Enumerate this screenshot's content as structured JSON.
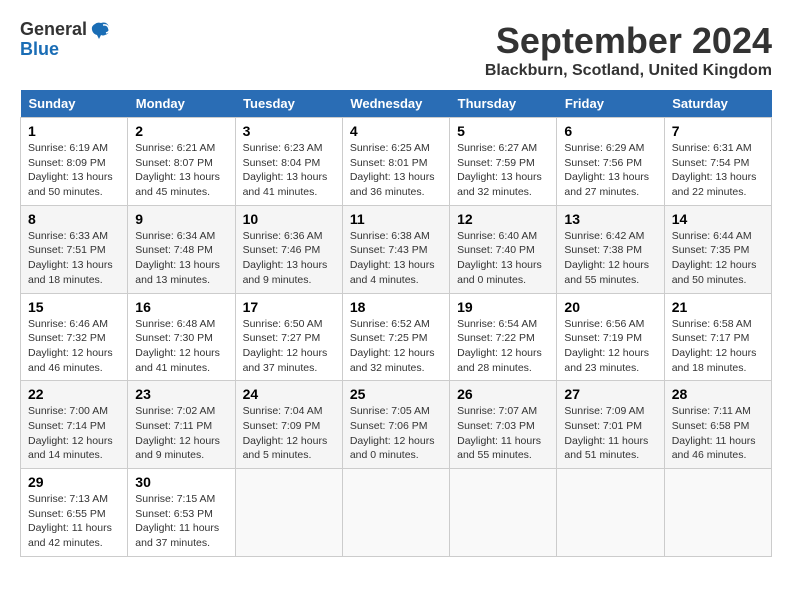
{
  "header": {
    "logo_line1": "General",
    "logo_line2": "Blue",
    "title": "September 2024",
    "location": "Blackburn, Scotland, United Kingdom"
  },
  "calendar": {
    "days_of_week": [
      "Sunday",
      "Monday",
      "Tuesday",
      "Wednesday",
      "Thursday",
      "Friday",
      "Saturday"
    ],
    "weeks": [
      [
        {
          "day": "1",
          "sunrise": "6:19 AM",
          "sunset": "8:09 PM",
          "daylight": "13 hours and 50 minutes."
        },
        {
          "day": "2",
          "sunrise": "6:21 AM",
          "sunset": "8:07 PM",
          "daylight": "13 hours and 45 minutes."
        },
        {
          "day": "3",
          "sunrise": "6:23 AM",
          "sunset": "8:04 PM",
          "daylight": "13 hours and 41 minutes."
        },
        {
          "day": "4",
          "sunrise": "6:25 AM",
          "sunset": "8:01 PM",
          "daylight": "13 hours and 36 minutes."
        },
        {
          "day": "5",
          "sunrise": "6:27 AM",
          "sunset": "7:59 PM",
          "daylight": "13 hours and 32 minutes."
        },
        {
          "day": "6",
          "sunrise": "6:29 AM",
          "sunset": "7:56 PM",
          "daylight": "13 hours and 27 minutes."
        },
        {
          "day": "7",
          "sunrise": "6:31 AM",
          "sunset": "7:54 PM",
          "daylight": "13 hours and 22 minutes."
        }
      ],
      [
        {
          "day": "8",
          "sunrise": "6:33 AM",
          "sunset": "7:51 PM",
          "daylight": "13 hours and 18 minutes."
        },
        {
          "day": "9",
          "sunrise": "6:34 AM",
          "sunset": "7:48 PM",
          "daylight": "13 hours and 13 minutes."
        },
        {
          "day": "10",
          "sunrise": "6:36 AM",
          "sunset": "7:46 PM",
          "daylight": "13 hours and 9 minutes."
        },
        {
          "day": "11",
          "sunrise": "6:38 AM",
          "sunset": "7:43 PM",
          "daylight": "13 hours and 4 minutes."
        },
        {
          "day": "12",
          "sunrise": "6:40 AM",
          "sunset": "7:40 PM",
          "daylight": "13 hours and 0 minutes."
        },
        {
          "day": "13",
          "sunrise": "6:42 AM",
          "sunset": "7:38 PM",
          "daylight": "12 hours and 55 minutes."
        },
        {
          "day": "14",
          "sunrise": "6:44 AM",
          "sunset": "7:35 PM",
          "daylight": "12 hours and 50 minutes."
        }
      ],
      [
        {
          "day": "15",
          "sunrise": "6:46 AM",
          "sunset": "7:32 PM",
          "daylight": "12 hours and 46 minutes."
        },
        {
          "day": "16",
          "sunrise": "6:48 AM",
          "sunset": "7:30 PM",
          "daylight": "12 hours and 41 minutes."
        },
        {
          "day": "17",
          "sunrise": "6:50 AM",
          "sunset": "7:27 PM",
          "daylight": "12 hours and 37 minutes."
        },
        {
          "day": "18",
          "sunrise": "6:52 AM",
          "sunset": "7:25 PM",
          "daylight": "12 hours and 32 minutes."
        },
        {
          "day": "19",
          "sunrise": "6:54 AM",
          "sunset": "7:22 PM",
          "daylight": "12 hours and 28 minutes."
        },
        {
          "day": "20",
          "sunrise": "6:56 AM",
          "sunset": "7:19 PM",
          "daylight": "12 hours and 23 minutes."
        },
        {
          "day": "21",
          "sunrise": "6:58 AM",
          "sunset": "7:17 PM",
          "daylight": "12 hours and 18 minutes."
        }
      ],
      [
        {
          "day": "22",
          "sunrise": "7:00 AM",
          "sunset": "7:14 PM",
          "daylight": "12 hours and 14 minutes."
        },
        {
          "day": "23",
          "sunrise": "7:02 AM",
          "sunset": "7:11 PM",
          "daylight": "12 hours and 9 minutes."
        },
        {
          "day": "24",
          "sunrise": "7:04 AM",
          "sunset": "7:09 PM",
          "daylight": "12 hours and 5 minutes."
        },
        {
          "day": "25",
          "sunrise": "7:05 AM",
          "sunset": "7:06 PM",
          "daylight": "12 hours and 0 minutes."
        },
        {
          "day": "26",
          "sunrise": "7:07 AM",
          "sunset": "7:03 PM",
          "daylight": "11 hours and 55 minutes."
        },
        {
          "day": "27",
          "sunrise": "7:09 AM",
          "sunset": "7:01 PM",
          "daylight": "11 hours and 51 minutes."
        },
        {
          "day": "28",
          "sunrise": "7:11 AM",
          "sunset": "6:58 PM",
          "daylight": "11 hours and 46 minutes."
        }
      ],
      [
        {
          "day": "29",
          "sunrise": "7:13 AM",
          "sunset": "6:55 PM",
          "daylight": "11 hours and 42 minutes."
        },
        {
          "day": "30",
          "sunrise": "7:15 AM",
          "sunset": "6:53 PM",
          "daylight": "11 hours and 37 minutes."
        },
        null,
        null,
        null,
        null,
        null
      ]
    ]
  }
}
